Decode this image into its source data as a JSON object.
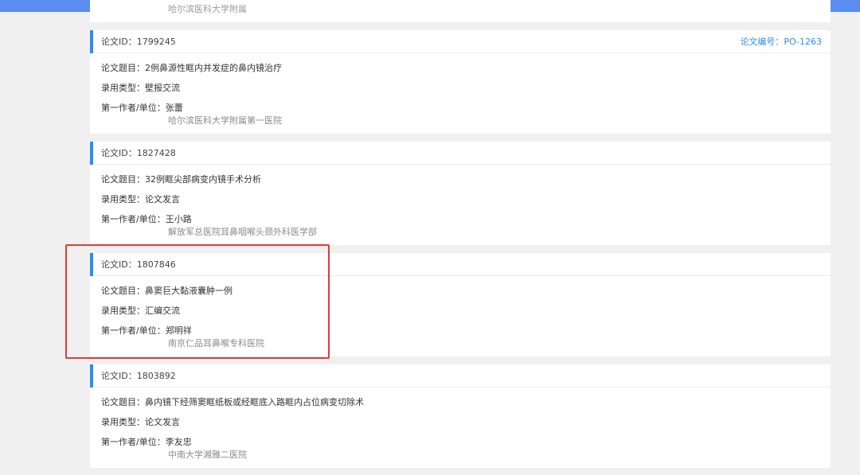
{
  "colors": {
    "top_bar": "#5b8df0",
    "accent": "#2d8cf0",
    "highlight": "#e23b3b"
  },
  "partial_card": {
    "cut_text": "哈尔滨医科大学附属"
  },
  "papers": [
    {
      "id_label": "论文ID：1799245",
      "number_label": "论文编号：PO-1263",
      "title_label": "论文题目：2例鼻源性眶内并发症的鼻内镜治疗",
      "type_label": "录用类型：壁报交流",
      "author_label": "第一作者/单位：张蕾",
      "unit": "哈尔滨医科大学附属第一医院"
    },
    {
      "id_label": "论文ID：1827428",
      "number_label": "",
      "title_label": "论文题目：32例眶尖部病变内镜手术分析",
      "type_label": "录用类型：论文发言",
      "author_label": "第一作者/单位：王小路",
      "unit": "解放军总医院耳鼻咽喉头颈外科医学部"
    },
    {
      "id_label": "论文ID：1807846",
      "number_label": "",
      "title_label": "论文题目：鼻窦巨大黏液囊肿一例",
      "type_label": "录用类型：汇编交流",
      "author_label": "第一作者/单位：郑明祥",
      "unit": "南京仁品耳鼻喉专科医院"
    },
    {
      "id_label": "论文ID：1803892",
      "number_label": "",
      "title_label": "论文题目：鼻内镜下经筛窦眶纸板或经眶底入路眶内占位病变切除术",
      "type_label": "录用类型：论文发言",
      "author_label": "第一作者/单位：李友忠",
      "unit": "中南大学湘雅二医院"
    }
  ]
}
